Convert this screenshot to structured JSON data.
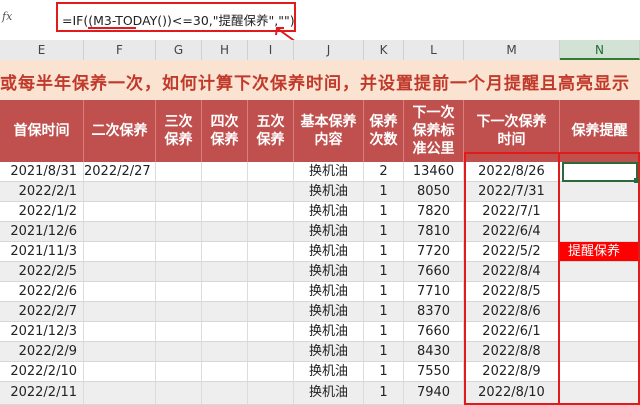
{
  "formula_bar": {
    "fx_label": "fx",
    "formula": "=IF((M3-TODAY())<=30,\"提醒保养\",\"\")"
  },
  "columns": [
    "E",
    "F",
    "G",
    "H",
    "I",
    "J",
    "K",
    "L",
    "M",
    "N"
  ],
  "title": "或每半年保养一次，如何计算下次保养时间，并设置提前一个月提醒且高亮显示",
  "headers": {
    "first_date": "首保时间",
    "second": "二次保养",
    "third": "三次\n保养",
    "fourth": "四次\n保养",
    "fifth": "五次\n保养",
    "content": "基本保养\n内容",
    "count": "保养\n次数",
    "km": "下一次\n保养标\n准公里",
    "next_time": "下一次保养\n时间",
    "reminder": "保养提醒"
  },
  "rows": [
    {
      "first_date": "2021/8/31",
      "second": "2022/2/27",
      "content": "换机油",
      "count": "2",
      "km": "13460",
      "next": "2022/8/26",
      "reminder": ""
    },
    {
      "first_date": "2022/2/1",
      "second": "",
      "content": "换机油",
      "count": "1",
      "km": "8050",
      "next": "2022/7/31",
      "reminder": ""
    },
    {
      "first_date": "2022/1/2",
      "second": "",
      "content": "换机油",
      "count": "1",
      "km": "7820",
      "next": "2022/7/1",
      "reminder": ""
    },
    {
      "first_date": "2021/12/6",
      "second": "",
      "content": "换机油",
      "count": "1",
      "km": "7810",
      "next": "2022/6/4",
      "reminder": ""
    },
    {
      "first_date": "2021/11/3",
      "second": "",
      "content": "换机油",
      "count": "1",
      "km": "7720",
      "next": "2022/5/2",
      "reminder": "提醒保养"
    },
    {
      "first_date": "2022/2/5",
      "second": "",
      "content": "换机油",
      "count": "1",
      "km": "7660",
      "next": "2022/8/4",
      "reminder": ""
    },
    {
      "first_date": "2022/2/6",
      "second": "",
      "content": "换机油",
      "count": "1",
      "km": "7710",
      "next": "2022/8/5",
      "reminder": ""
    },
    {
      "first_date": "2022/2/7",
      "second": "",
      "content": "换机油",
      "count": "1",
      "km": "8370",
      "next": "2022/8/6",
      "reminder": ""
    },
    {
      "first_date": "2021/12/3",
      "second": "",
      "content": "换机油",
      "count": "1",
      "km": "7660",
      "next": "2022/6/1",
      "reminder": ""
    },
    {
      "first_date": "2022/2/9",
      "second": "",
      "content": "换机油",
      "count": "1",
      "km": "8430",
      "next": "2022/8/8",
      "reminder": ""
    },
    {
      "first_date": "2022/2/10",
      "second": "",
      "content": "换机油",
      "count": "1",
      "km": "7550",
      "next": "2022/8/9",
      "reminder": ""
    },
    {
      "first_date": "2022/2/11",
      "second": "",
      "content": "换机油",
      "count": "1",
      "km": "7940",
      "next": "2022/8/10",
      "reminder": ""
    }
  ],
  "colors": {
    "header_bg": "#c0504d",
    "title_bg": "#fbe3d1",
    "title_text": "#c0392b",
    "alert_bg": "#ff0000",
    "annotation": "#e11b1b"
  }
}
